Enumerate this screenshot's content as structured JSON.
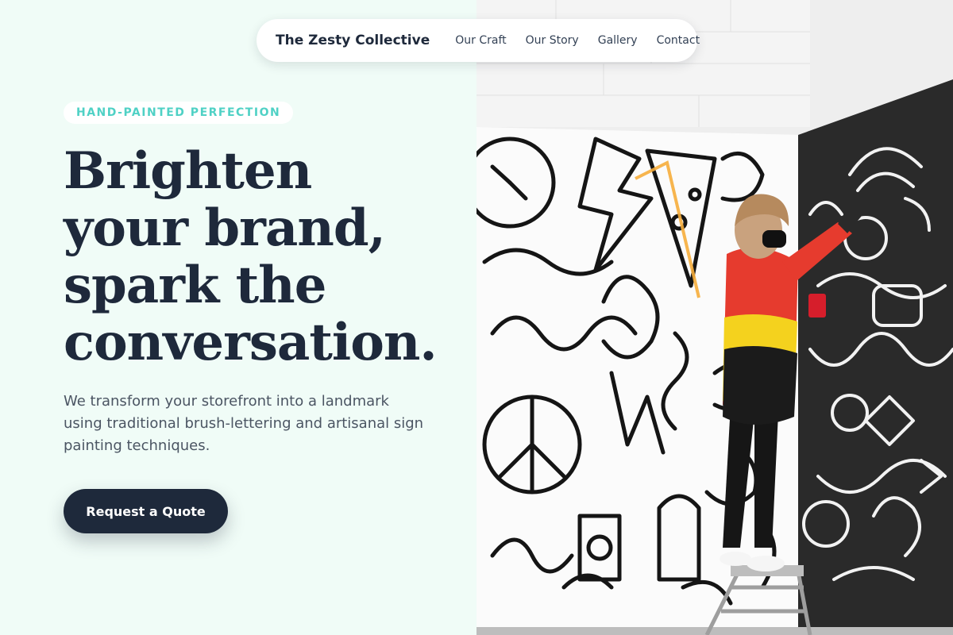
{
  "nav": {
    "brand": "The Zesty Collective",
    "links": [
      "Our Craft",
      "Our Story",
      "Gallery",
      "Contact"
    ]
  },
  "hero": {
    "eyebrow": "HAND-PAINTED PERFECTION",
    "headline_lines": [
      "Brighten",
      "your brand,",
      "spark the",
      "conversation."
    ],
    "subtext": "We transform your storefront into a landmark using traditional brush-lettering and artisanal sign painting techniques.",
    "cta_label": "Request a Quote"
  },
  "colors": {
    "background": "#f0fcf7",
    "ink": "#1e293b",
    "accent": "#4fd1c5"
  }
}
